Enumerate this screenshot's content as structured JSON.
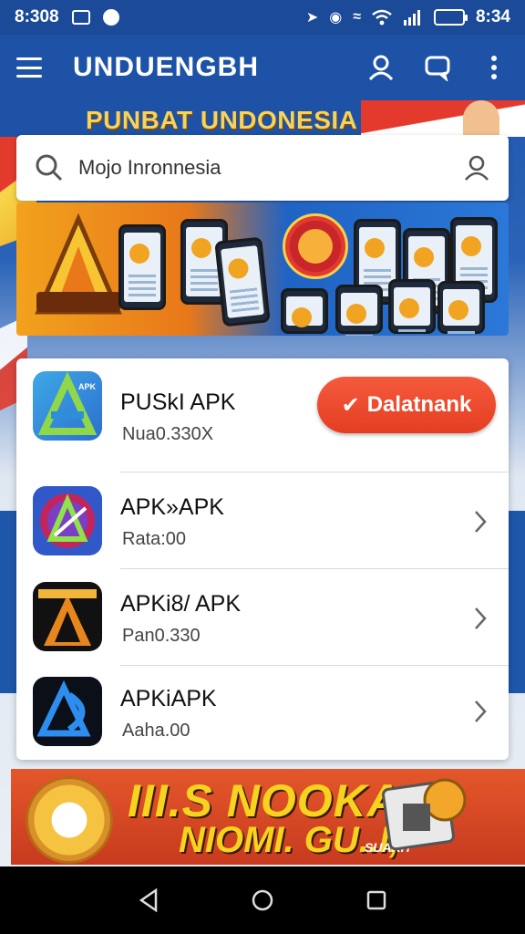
{
  "status_bar": {
    "time_left": "8:308",
    "time_right": "8:34"
  },
  "app_bar": {
    "title": "UNDUENGBH",
    "icons": [
      "menu-icon",
      "profile-icon",
      "chat-icon",
      "more-icon"
    ]
  },
  "banner": {
    "title": "PUNBAT UNDONESIA"
  },
  "search": {
    "value": "Mojo Inronnesia"
  },
  "apps": [
    {
      "name": "PUSkI APK",
      "meta": "Nua0.330X",
      "action": "Dalatnank",
      "icon": "apk-blue-icon"
    },
    {
      "name": "APK»APK",
      "meta": "Rata:00",
      "icon": "apk-purple-icon"
    },
    {
      "name": "APKi8/ APK",
      "meta": "Pan0.330",
      "icon": "apk-orange-icon"
    },
    {
      "name": "APKiAPK",
      "meta": "Aaha.00",
      "icon": "apk-black-icon"
    }
  ],
  "bottom_ad": {
    "line1": "III.S NOOKANI",
    "line2": "NIOMI. GU..I,",
    "sub": "SUARH"
  },
  "colors": {
    "primary": "#1d52a6",
    "accent": "#e43e22",
    "banner_text": "#f6d35a"
  }
}
